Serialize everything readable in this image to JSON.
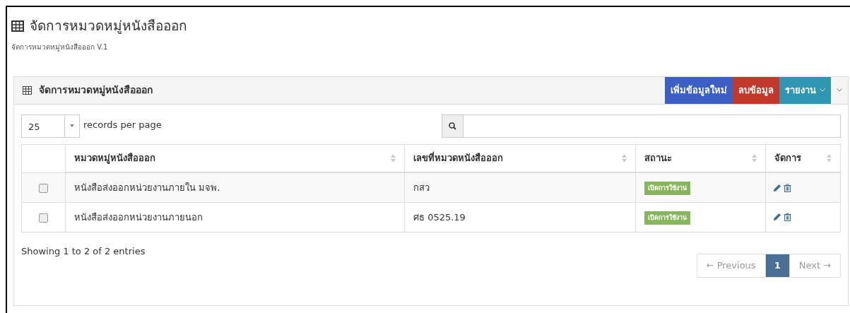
{
  "page": {
    "title": "จัดการหมวดหมู่หนังสือออก",
    "subtitle": "จัดการหมวดหมู่หนังสือออก V.1"
  },
  "panel": {
    "title": "จัดการหมวดหมู่หนังสือออก",
    "buttons": [
      {
        "label": "เพิ่มข้อมูลใหม่",
        "kind": "primary"
      },
      {
        "label": "ลบข้อมูล",
        "kind": "danger"
      },
      {
        "label": "รายงาน",
        "kind": "dropdown"
      }
    ]
  },
  "page_size": {
    "value": "25",
    "label": "records per page"
  },
  "table": {
    "columns": [
      "หมวดหมู่หนังสือออก",
      "เลขที่หมวดหนังสือออก",
      "สถานะ",
      "จัดการ"
    ],
    "rows": [
      {
        "checked": false,
        "name": "หนังสือส่งออกหน่วยงานภายใน มจพ.",
        "number": "กสว",
        "status": "เปิดการใช้งาน"
      },
      {
        "checked": false,
        "name": "หนังสือส่งออกหน่วยงานภายนอก",
        "number": "ศธ 0525.19",
        "status": "เปิดการใช้งาน"
      }
    ]
  },
  "info": "Showing 1 to 2 of 2 entries",
  "pagination": [
    {
      "label": "← Previous",
      "kind": "prev",
      "selected": false
    },
    {
      "label": "1",
      "kind": "page",
      "selected": true
    },
    {
      "label": "Next →",
      "kind": "next",
      "selected": false
    }
  ]
}
